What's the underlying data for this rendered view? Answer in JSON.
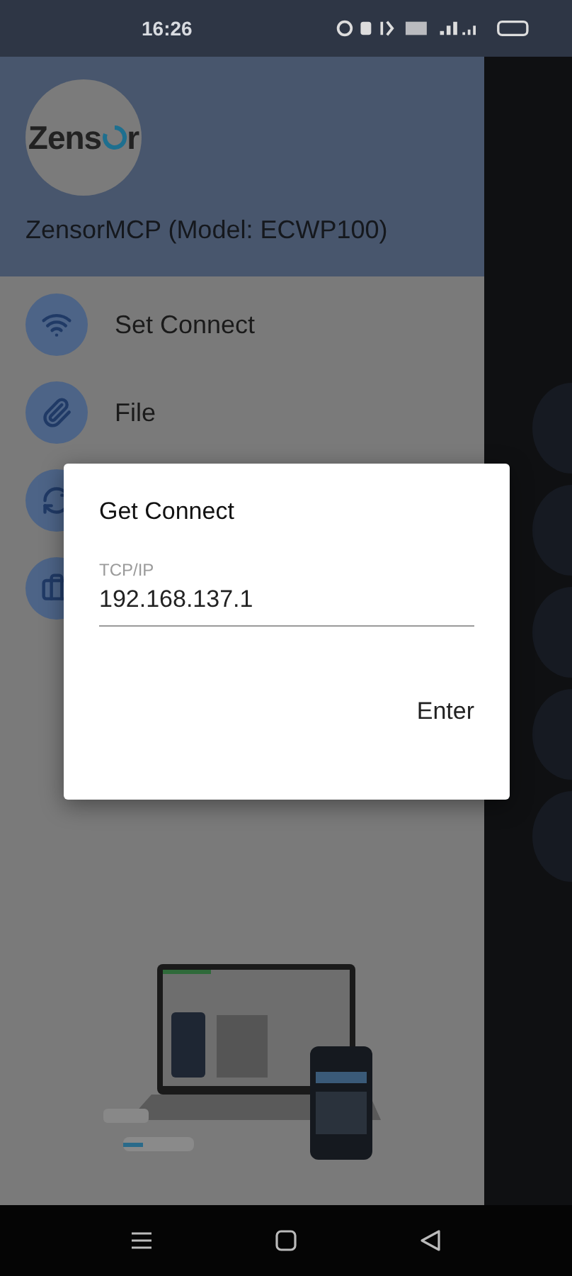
{
  "status_bar": {
    "time": "16:26"
  },
  "drawer": {
    "logo": {
      "prefix": "Zens",
      "suffix": "r"
    },
    "title": "ZensorMCP (Model: ECWP100)",
    "items": [
      {
        "kind": "entry",
        "label": "Set Connect"
      },
      {
        "kind": "entry",
        "label": "File"
      },
      {
        "kind": "covered"
      },
      {
        "kind": "covered"
      }
    ]
  },
  "dialog": {
    "title": "Get Connect",
    "field": {
      "label": "TCP/IP",
      "value": "192.168.137.1"
    },
    "button": "Enter"
  }
}
